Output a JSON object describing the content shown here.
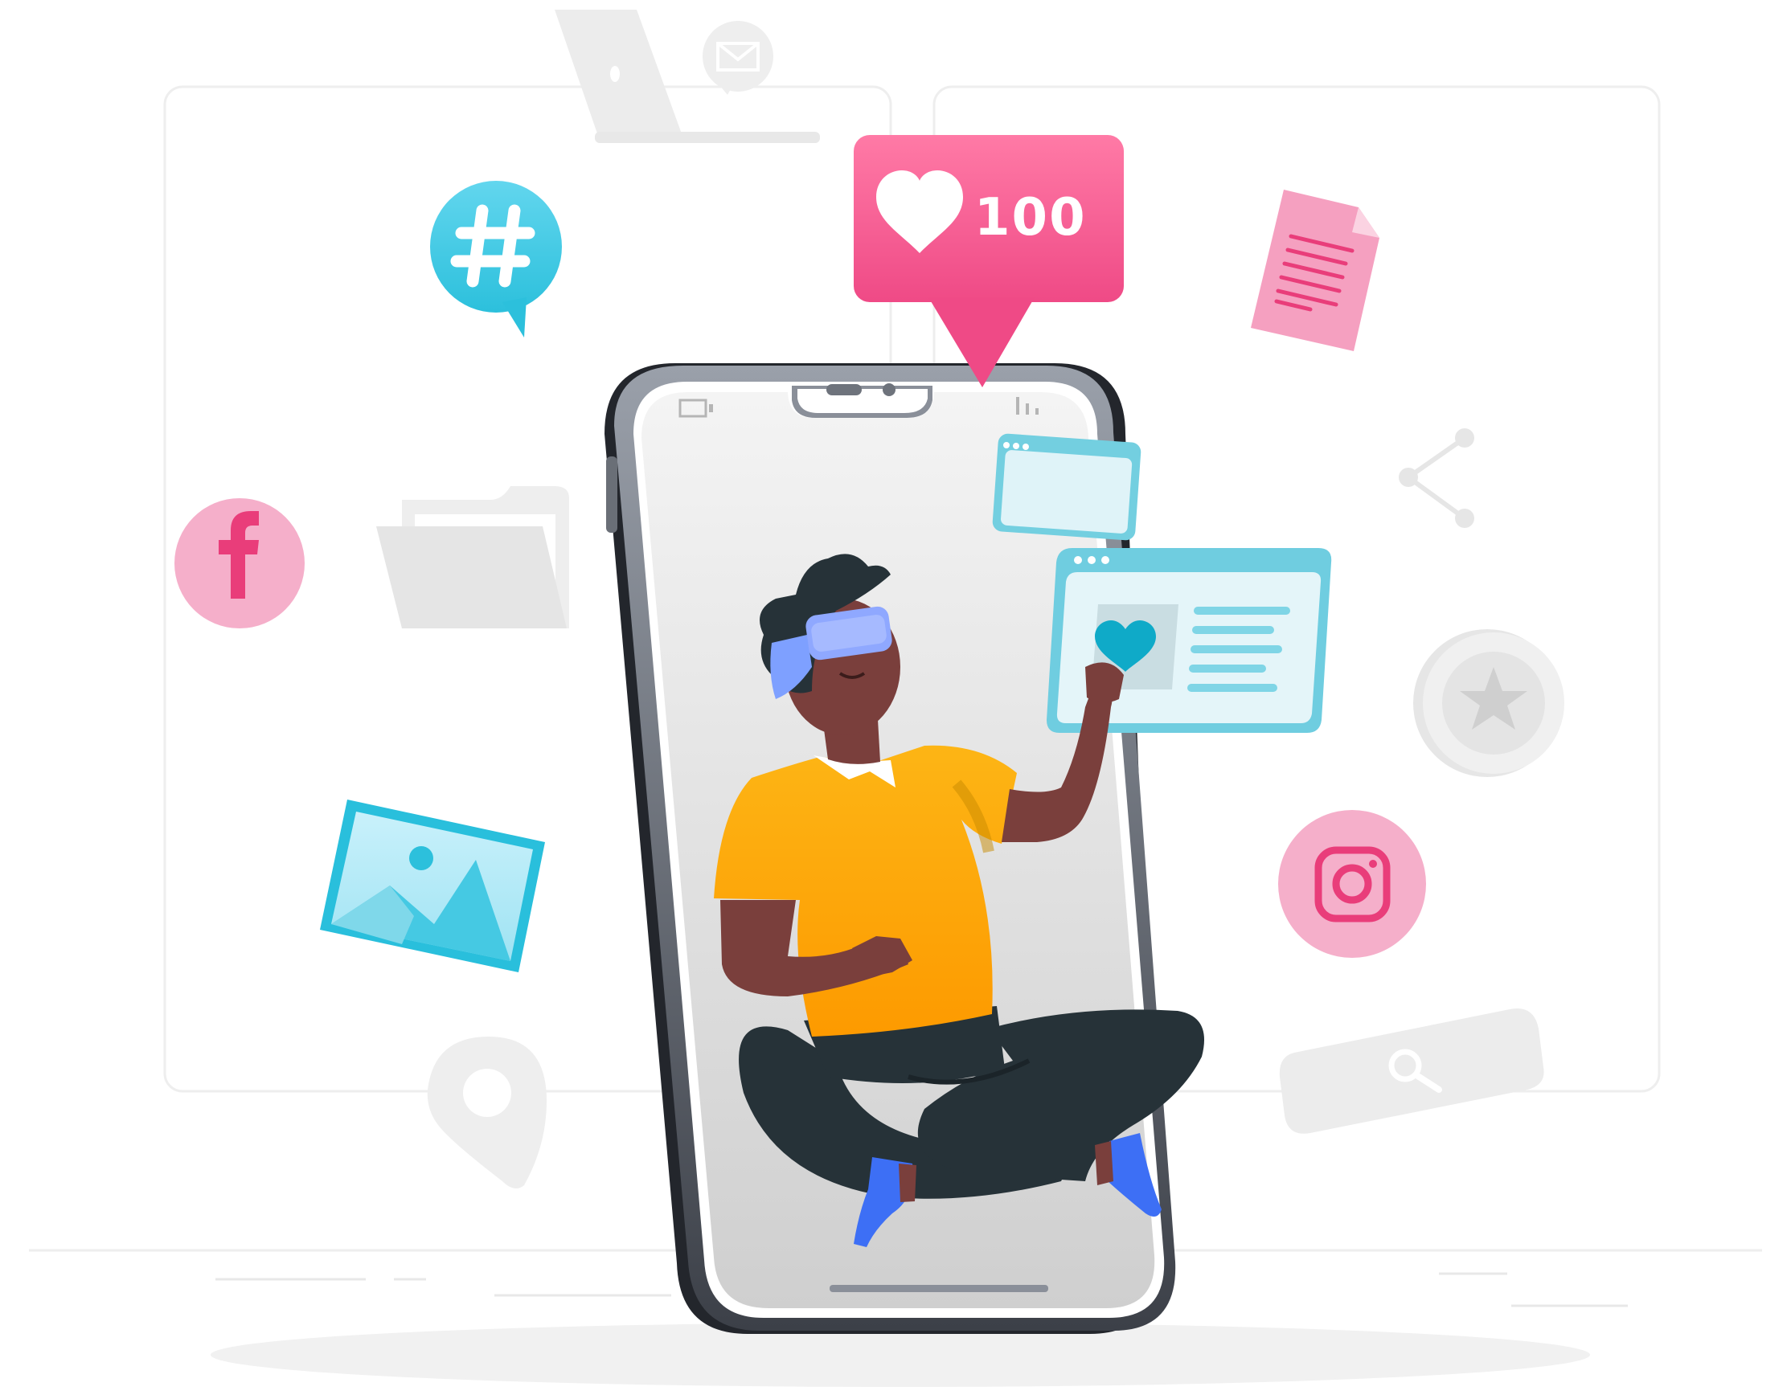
{
  "like_badge": {
    "count": "100",
    "color": "#f0588f"
  },
  "palette": {
    "pink": "#f5a9c5",
    "pink_strong": "#e93d7a",
    "cyan": "#29bfdc",
    "cyan_light": "#dff3f8",
    "grey_bg": "#f0f0f0",
    "grey_icon": "#e6e6e6",
    "skin": "#7a3f3c",
    "shirt": "#fcae14",
    "pants": "#263238",
    "socks": "#3d6ff5",
    "vr": "#8fa8ff"
  },
  "icons": [
    "hashtag-icon",
    "facebook-icon",
    "instagram-icon",
    "folder-icon",
    "image-icon",
    "location-pin-icon",
    "document-icon",
    "share-icon",
    "star-coin-icon",
    "search-bar-icon",
    "laptop-icon",
    "mail-bubble-icon",
    "heart-icon",
    "browser-window-icon"
  ]
}
